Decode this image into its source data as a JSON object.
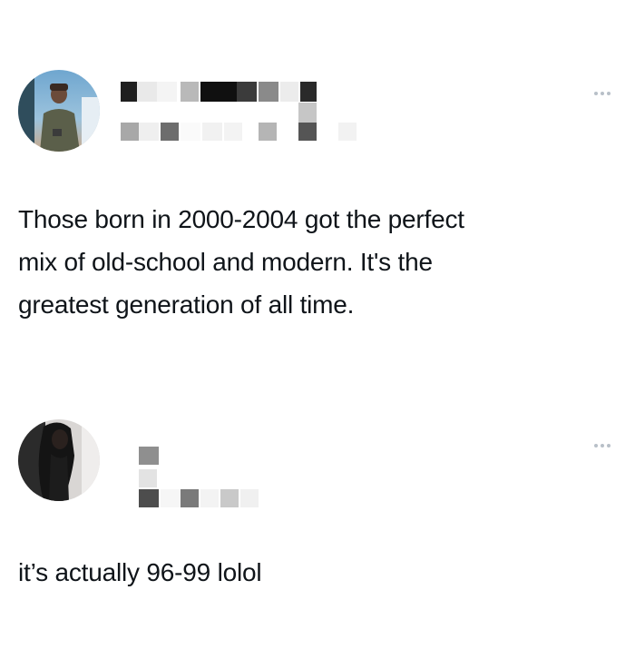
{
  "posts": [
    {
      "avatar": "profile-photo-man-outdoors",
      "author_name": "",
      "author_handle": "",
      "text": "Those born in 2000-2004 got the perfect\nmix of old-school and modern. It's the\ngreatest generation of all time.",
      "menu_icon": "more-options-icon"
    },
    {
      "avatar": "profile-photo-woman-dark-hair",
      "author_name": "",
      "author_handle": "",
      "text": "it’s actually 96-99 lolol",
      "menu_icon": "more-options-icon"
    }
  ],
  "colors": {
    "text": "#0f1419",
    "muted": "#b8c0c8",
    "background": "#ffffff"
  }
}
